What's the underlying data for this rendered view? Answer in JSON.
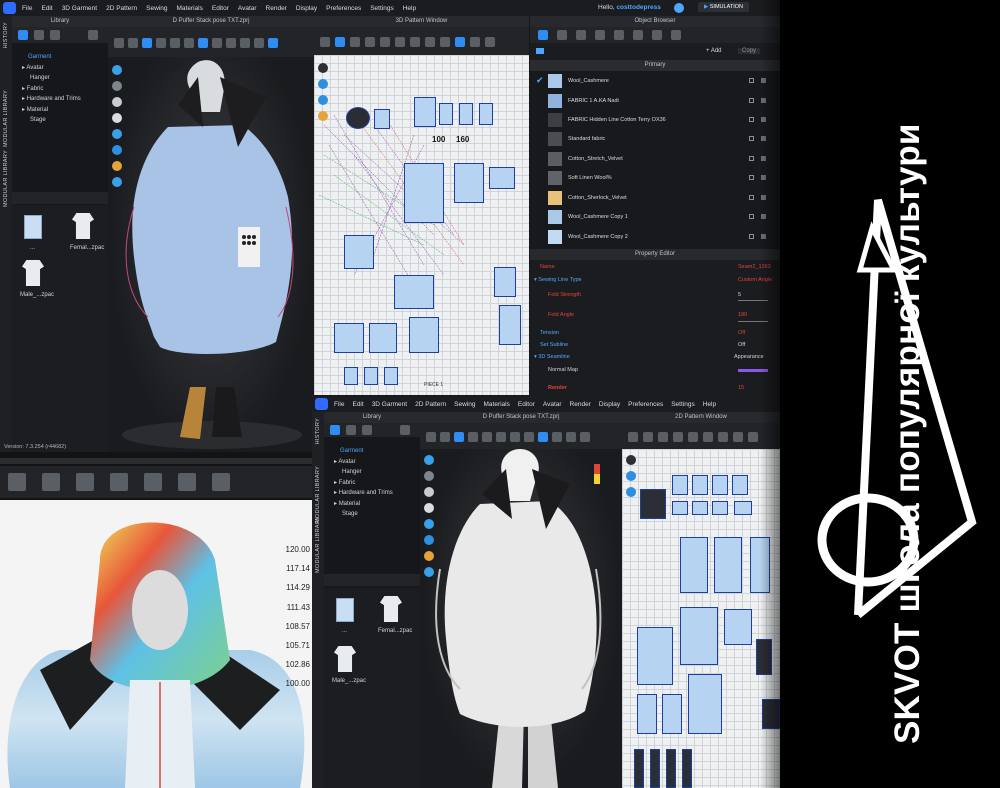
{
  "top_window": {
    "menu": [
      "File",
      "Edit",
      "3D Garment",
      "2D Pattern",
      "Sewing",
      "Materials",
      "Editor",
      "Avatar",
      "Render",
      "Display",
      "Preferences",
      "Settings",
      "Help"
    ],
    "greeting": "Hello,",
    "username": "costtodepress",
    "mode": "SIMULATION",
    "library_title": "Library",
    "file_title": "D Puffer Stack pose TXT.zprj",
    "pattern_title": "3D Pattern Window",
    "object_browser_title": "Object Browser",
    "side_tabs": [
      "HISTORY",
      "MODULAR LIBRARY",
      "MODULAR LIBRARY"
    ],
    "tree": [
      "Garment",
      "Avatar",
      "Hanger",
      "Fabric",
      "Hardware and Trims",
      "Material",
      "Stage"
    ],
    "files": [
      "...",
      "Femal...zpac",
      "Male_...zpac"
    ],
    "ob_add": "+ Add",
    "ob_copy": "Copy",
    "ob_primary": "Primary",
    "fabrics": [
      {
        "name": "Wool_Cashmere",
        "color": "#a9c8ea"
      },
      {
        "name": "FABRIC 1 A.KA Nadi",
        "color": "#8fb3dc"
      },
      {
        "name": "FABRIC Hidden Line Cotton Terry OX36",
        "color": "#3c3f44"
      },
      {
        "name": "Standard fabric",
        "color": "#4a4d52"
      },
      {
        "name": "Cotton_Stretch_Velvet",
        "color": "#5a5d62"
      },
      {
        "name": "Soft Linen Wool%",
        "color": "#606368"
      },
      {
        "name": "Cotton_Sherlock_Velvet",
        "color": "#e8c27a"
      },
      {
        "name": "Wool_Cashmere Copy 1",
        "color": "#a9c8ea"
      },
      {
        "name": "Wool_Cashmere Copy 2",
        "color": "#c2daf2"
      }
    ],
    "property_title": "Property Editor",
    "props": {
      "name_label": "Name",
      "name_value": "Seam2_1363",
      "sewing_line_type": "Sewing Line Type",
      "sewing_line_value": "Custom Angle",
      "fold_strength": "Fold Strength",
      "fold_strength_value": "5",
      "fold_angle": "Fold Angle",
      "fold_angle_value": "180",
      "tension": "Tension",
      "tension_value": "Off",
      "set_subline": "Set Subline",
      "set_subline_value": "Off",
      "seamline_3d": "3D Seamline",
      "seamline_value": "Appearance",
      "normal_map": "Normal Map",
      "render": "Render",
      "render_value": "15"
    },
    "pattern_label": "PIECE 1",
    "pattern_tag_1": "100",
    "pattern_tag_2": "160"
  },
  "left_strain": {
    "version": "Version: 7.3.254 (r44682)",
    "scale": [
      "120.00",
      "117.14",
      "114.29",
      "111.43",
      "108.57",
      "105.71",
      "102.86",
      "100.00"
    ]
  },
  "bottom_window": {
    "menu": [
      "File",
      "Edit",
      "3D Garment",
      "2D Pattern",
      "Sewing",
      "Materials",
      "Editor",
      "Avatar",
      "Render",
      "Display",
      "Preferences",
      "Settings",
      "Help"
    ],
    "library_title": "Library",
    "file_title": "D Puffer Stack pose TXT.zprj",
    "pattern_title": "2D Pattern Window",
    "side_tabs": [
      "HISTORY",
      "MODULAR LIBRARY",
      "MODULAR LIBRARY"
    ],
    "tree": [
      "Garment",
      "Avatar",
      "Hanger",
      "Fabric",
      "Hardware and Trims",
      "Material",
      "Stage"
    ],
    "files": [
      "...",
      "Femal...zpac",
      "Male_...zpac"
    ]
  },
  "brand": {
    "text": "SKVOT школа популярної культури",
    "colors": {
      "bg": "#000000",
      "fg": "#ffffff"
    }
  },
  "colors": {
    "accent": "#2f8cf3",
    "panel": "#1b1c1f",
    "alert": "#e0453a"
  }
}
